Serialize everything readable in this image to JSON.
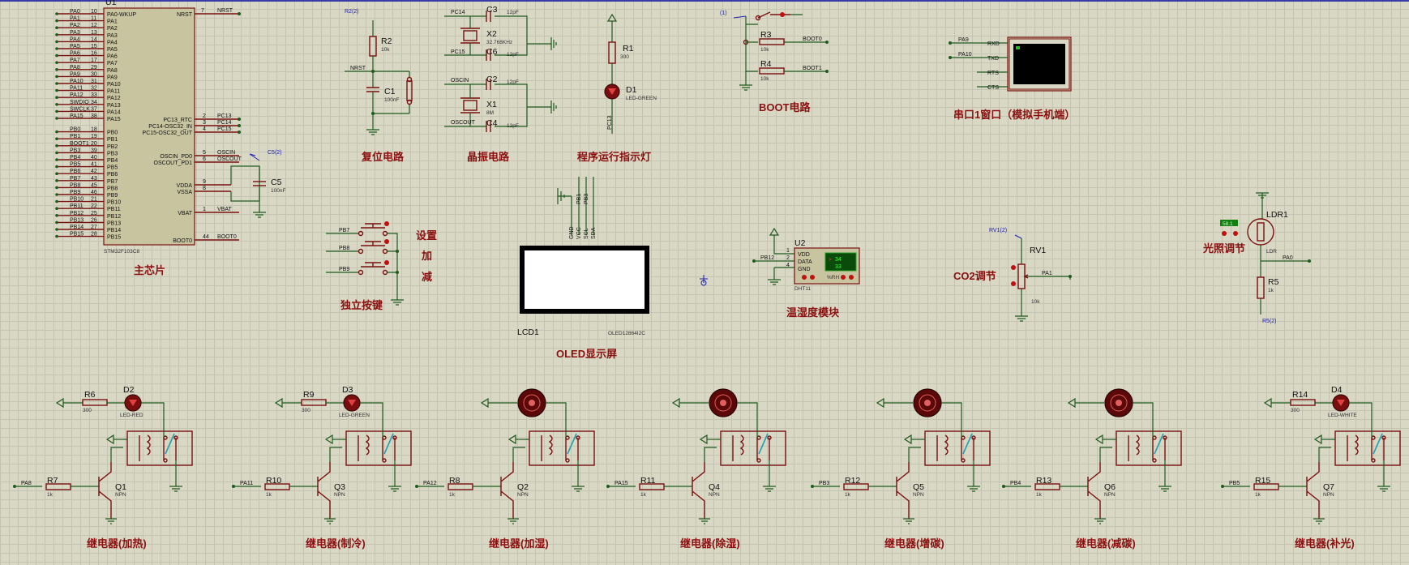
{
  "sections": {
    "main_chip": "主芯片",
    "reset": "复位电路",
    "crystal": "晶振电路",
    "led_indicator": "程序运行指示灯",
    "boot": "BOOT电路",
    "serial": "串口1窗口（模拟手机端）",
    "keys": "独立按键",
    "key_set": "设置",
    "key_add": "加",
    "key_sub": "减",
    "oled": "OLED显示屏",
    "dht": "温湿度模块",
    "co2": "CO2调节",
    "light": "光照调节",
    "relay_heat": "继电器(加热)",
    "relay_cool": "继电器(制冷)",
    "relay_humid": "继电器(加湿)",
    "relay_dehumid": "继电器(除湿)",
    "relay_co2_add": "继电器(增碳)",
    "relay_co2_sub": "继电器(减碳)",
    "relay_light": "继电器(补光)"
  },
  "mcu": {
    "ref": "U1",
    "part": "STM32F103C8",
    "left_pins": [
      {
        "net": "PA0",
        "num": "10",
        "name": "PA0-WKUP"
      },
      {
        "net": "PA1",
        "num": "11",
        "name": "PA1"
      },
      {
        "net": "PA2",
        "num": "12",
        "name": "PA2"
      },
      {
        "net": "PA3",
        "num": "13",
        "name": "PA3"
      },
      {
        "net": "PA4",
        "num": "14",
        "name": "PA4"
      },
      {
        "net": "PA5",
        "num": "15",
        "name": "PA5"
      },
      {
        "net": "PA6",
        "num": "16",
        "name": "PA6"
      },
      {
        "net": "PA7",
        "num": "17",
        "name": "PA7"
      },
      {
        "net": "PA8",
        "num": "29",
        "name": "PA8"
      },
      {
        "net": "PA9",
        "num": "30",
        "name": "PA9"
      },
      {
        "net": "PA10",
        "num": "31",
        "name": "PA10"
      },
      {
        "net": "PA11",
        "num": "32",
        "name": "PA11"
      },
      {
        "net": "PA12",
        "num": "33",
        "name": "PA12"
      },
      {
        "net": "SWDIO",
        "num": "34",
        "name": "PA13"
      },
      {
        "net": "SWCLK",
        "num": "37",
        "name": "PA14"
      },
      {
        "net": "PA15",
        "num": "38",
        "name": "PA15"
      },
      {
        "net": "",
        "num": "",
        "name": ""
      },
      {
        "net": "PB0",
        "num": "18",
        "name": "PB0"
      },
      {
        "net": "PB1",
        "num": "19",
        "name": "PB1"
      },
      {
        "net": "BOOT1",
        "num": "20",
        "name": "PB2"
      },
      {
        "net": "PB3",
        "num": "39",
        "name": "PB3"
      },
      {
        "net": "PB4",
        "num": "40",
        "name": "PB4"
      },
      {
        "net": "PB5",
        "num": "41",
        "name": "PB5"
      },
      {
        "net": "PB6",
        "num": "42",
        "name": "PB6"
      },
      {
        "net": "PB7",
        "num": "43",
        "name": "PB7"
      },
      {
        "net": "PB8",
        "num": "45",
        "name": "PB8"
      },
      {
        "net": "PB9",
        "num": "46",
        "name": "PB9"
      },
      {
        "net": "PB10",
        "num": "21",
        "name": "PB10"
      },
      {
        "net": "PB11",
        "num": "22",
        "name": "PB11"
      },
      {
        "net": "PB12",
        "num": "25",
        "name": "PB12"
      },
      {
        "net": "PB13",
        "num": "26",
        "name": "PB13"
      },
      {
        "net": "PB14",
        "num": "27",
        "name": "PB14"
      },
      {
        "net": "PB15",
        "num": "28",
        "name": "PB15"
      }
    ],
    "right_pins": {
      "nrst": {
        "num": "7",
        "name": "NRST",
        "net": "NRST"
      },
      "pc13": {
        "num": "2",
        "name": "PC13_RTC",
        "net": "PC13"
      },
      "pc14": {
        "num": "3",
        "name": "PC14-OSC32_IN",
        "net": "PC14"
      },
      "pc15": {
        "num": "4",
        "name": "PC15-OSC32_OUT",
        "net": "PC15"
      },
      "oscin": {
        "num": "5",
        "name": "OSCIN_PD0",
        "net": "OSCIN"
      },
      "oscout": {
        "num": "6",
        "name": "OSCOUT_PD1",
        "net": "OSCOUT"
      },
      "vdda": {
        "num": "9",
        "name": "VDDA"
      },
      "vssa": {
        "num": "8",
        "name": "VSSA"
      },
      "vbat": {
        "num": "1",
        "name": "VBAT",
        "net": "VBAT"
      },
      "boot0": {
        "num": "44",
        "name": "BOOT0",
        "net": "BOOT0"
      }
    },
    "c5": {
      "ref": "C5",
      "val": "100nF",
      "probe": "C5(2)"
    }
  },
  "reset_circuit": {
    "r2": "R2",
    "r2v": "10k",
    "c1": "C1",
    "c1v": "100nF",
    "net": "NRST",
    "probe": "R2(2)"
  },
  "crystal_circuit": {
    "c3": "C3",
    "c3v": "12pF",
    "c6": "C6",
    "c6v": "12pF",
    "x2": "X2",
    "x2v": "32.768KHz",
    "c2": "C2",
    "c2v": "12pF",
    "c4": "C4",
    "c4v": "12pF",
    "x1": "X1",
    "x1v": "8M",
    "n1": "PC14",
    "n2": "PC15",
    "n3": "OSCIN",
    "n4": "OSCOUT"
  },
  "led_circuit": {
    "r1": "R1",
    "r1v": "300",
    "d1": "D1",
    "d1v": "LED-GREEN",
    "net": "PC13"
  },
  "boot_circuit": {
    "r3": "R3",
    "r3v": "10k",
    "r4": "R4",
    "r4v": "10k",
    "n1": "BOOT0",
    "n2": "BOOT1",
    "probe": "(1)"
  },
  "serial_terminal": {
    "pin_rxd": "RXD",
    "pin_txd": "TXD",
    "pin_rts": "RTS",
    "pin_cts": "CTS",
    "n1": "PA9",
    "n2": "PA10"
  },
  "keys": {
    "k1": "PB7",
    "k2": "PB8",
    "k3": "PB9"
  },
  "oled_module": {
    "ref": "LCD1",
    "part": "OLED12864I2C",
    "pins": [
      "GND",
      "VCC",
      "SCL",
      "SDA"
    ],
    "nets": [
      "PB1",
      "PB3"
    ]
  },
  "dht_module": {
    "ref": "U2",
    "part": "DHT11",
    "pins": [
      "VDD",
      "DATA",
      "GND"
    ],
    "nums": [
      "1",
      "2",
      "4"
    ],
    "net": "PB12",
    "reading1": "34",
    "reading2": "33",
    "unit1": "°C",
    "unit2": "%RH"
  },
  "co2_pot": {
    "ref": "RV1",
    "val": "10k",
    "net": "PA1",
    "probe": "RV1(2)"
  },
  "ldr": {
    "ref": "LDR1",
    "part": "LDR",
    "meter": "58.1",
    "r5": "R5",
    "r5v": "1k",
    "net": "PA0",
    "probe": "R5(2)"
  },
  "relays": [
    {
      "led_r": "R6",
      "led_rv": "300",
      "led": "D2",
      "led_v": "LED-RED",
      "net": "PA8",
      "base_r": "R7",
      "base_rv": "1k",
      "q": "Q1",
      "qv": "NPN",
      "load": "led",
      "led_color": "#b01010"
    },
    {
      "led_r": "R9",
      "led_rv": "300",
      "led": "D3",
      "led_v": "LED-GREEN",
      "net": "PA11",
      "base_r": "R10",
      "base_rv": "1k",
      "q": "Q3",
      "qv": "NPN",
      "load": "led",
      "led_color": "#b01010"
    },
    {
      "led_r": "",
      "led_rv": "",
      "led": "",
      "led_v": "",
      "net": "PA12",
      "base_r": "R8",
      "base_rv": "1k",
      "q": "Q2",
      "qv": "NPN",
      "load": "motor"
    },
    {
      "led_r": "",
      "led_rv": "",
      "led": "",
      "led_v": "",
      "net": "PA15",
      "base_r": "R11",
      "base_rv": "1k",
      "q": "Q4",
      "qv": "NPN",
      "load": "motor"
    },
    {
      "led_r": "",
      "led_rv": "",
      "led": "",
      "led_v": "",
      "net": "PB3",
      "base_r": "R12",
      "base_rv": "1k",
      "q": "Q5",
      "qv": "NPN",
      "load": "motor"
    },
    {
      "led_r": "",
      "led_rv": "",
      "led": "",
      "led_v": "",
      "net": "PB4",
      "base_r": "R13",
      "base_rv": "1k",
      "q": "Q6",
      "qv": "NPN",
      "load": "motor"
    },
    {
      "led_r": "R14",
      "led_rv": "300",
      "led": "D4",
      "led_v": "LED-WHITE",
      "net": "PB5",
      "base_r": "R15",
      "base_rv": "1k",
      "q": "Q7",
      "qv": "NPN",
      "load": "led",
      "led_color": "#b01010"
    }
  ]
}
